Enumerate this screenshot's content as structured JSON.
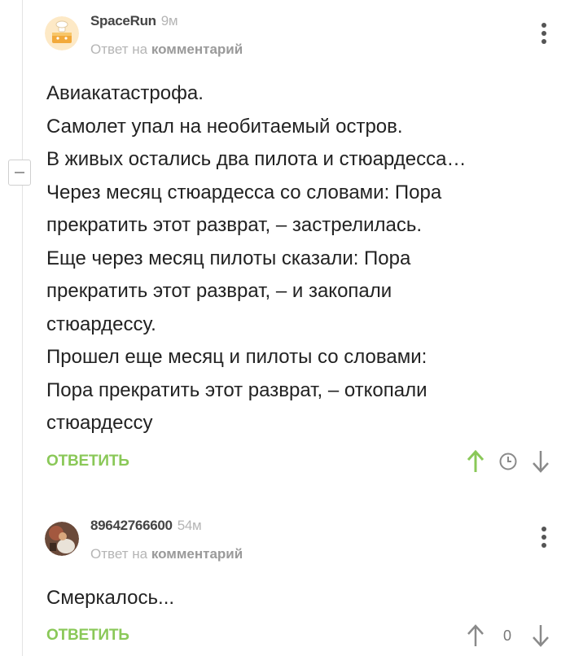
{
  "comments": [
    {
      "author": "SpaceRun",
      "time": "9м",
      "reply_prefix": "Ответ на",
      "reply_target": "комментарий",
      "avatar_icon": "cake-avatar-icon",
      "lines": [
        "Авиакатастрофа.",
        "Самолет упал на необитаемый остров.",
        "В живых остались два пилота и стюардесса…",
        "Через месяц стюардесса со словами: Пора",
        "прекратить этот разврат, – застрелилась.",
        "Еще через месяц пилоты сказали: Пора",
        "прекратить этот разврат, – и закопали",
        "стюардессу.",
        "Прошел еще месяц и пилоты со словами:",
        "Пора прекратить этот разврат, – откопали",
        "стюардессу"
      ],
      "reply_label": "ОТВЕТИТЬ",
      "upvote_color": "#8ac858"
    },
    {
      "author": "89642766600",
      "time": "54м",
      "reply_prefix": "Ответ на",
      "reply_target": "комментарий",
      "avatar_icon": "photo-avatar-icon",
      "lines": [
        "Смеркалось..."
      ],
      "reply_label": "ОТВЕТИТЬ",
      "rating": "0"
    }
  ],
  "colors": {
    "accent": "#8ac858",
    "muted": "#b5b5b5",
    "text": "#222222"
  }
}
